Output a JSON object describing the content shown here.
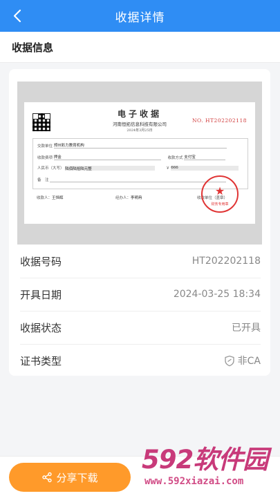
{
  "header": {
    "title": "收据详情",
    "back_icon": "chevron-left-icon"
  },
  "section": {
    "title": "收据信息"
  },
  "receipt": {
    "title": "电子收据",
    "company": "河南恒拓信息科技有限公司",
    "date": "2024年3月25日",
    "number": "NO. HT202202118",
    "payer_label": "交款单位",
    "payer_value": "郑州彩力教育机构",
    "fee_label": "收款费项",
    "fee_value": "押金",
    "method_label": "收款方式",
    "method_value": "支付宝",
    "rmb_label": "人民币（大写）",
    "rmb_value": "陆佰陆拾陆元整",
    "amount_symbol": "￥",
    "amount_value": "666",
    "remark_label": "备　注",
    "payee_label": "收款人：",
    "payee_value": "王恒辉",
    "handler_label": "经办人：",
    "handler_value": "李明冉",
    "unit_label": "收款单位（盖章）",
    "stamp_text": "财务专用章",
    "stamp_color": "#e03434"
  },
  "details": [
    {
      "label": "收据号码",
      "value": "HT202202118"
    },
    {
      "label": "开具日期",
      "value": "2024-03-25 18:34"
    },
    {
      "label": "收据状态",
      "value": "已开具"
    },
    {
      "label": "证书类型",
      "value": "非CA",
      "icon": "shield-icon"
    }
  ],
  "bottom": {
    "share_label": "分享下载",
    "share_icon": "share-icon",
    "share_color": "#ff9a2a"
  },
  "watermark": {
    "main": "592软件园",
    "url": "www.592xiazai.com"
  },
  "colors": {
    "primary": "#2f8df4",
    "background": "#f4f5f7"
  }
}
